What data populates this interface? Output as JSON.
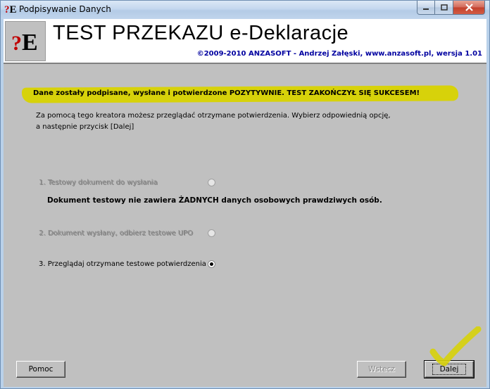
{
  "window": {
    "title": "Podpisywanie Danych",
    "icon_q": "?",
    "icon_e": "E"
  },
  "banner": {
    "logo_q": "?",
    "logo_e": "E",
    "title": "TEST PRZEKAZU e-Deklaracje",
    "subtitle": "©2009-2010 ANZASOFT - Andrzej Załęski, www.anzasoft.pl, wersja 1.01"
  },
  "status": {
    "message": "Dane zostały podpisane, wysłane i potwierdzone POZYTYWNIE. TEST ZAKOŃCZYŁ SIĘ SUKCESEM!",
    "highlight_color": "#d7d20a"
  },
  "description": {
    "line1": "Za pomocą tego kreatora możesz przeglądać otrzymane potwierdzenia. Wybierz odpowiednią opcję,",
    "line2": "a następnie przycisk [Dalej]"
  },
  "options": [
    {
      "label": "1. Testowy dokument do wysłania",
      "enabled": false,
      "selected": false
    },
    {
      "label": "2. Dokument wysłany, odbierz testowe UPO",
      "enabled": false,
      "selected": false
    },
    {
      "label": "3. Przeglądaj otrzymane testowe potwierdzenia",
      "enabled": true,
      "selected": true
    }
  ],
  "note": "Dokument testowy nie zawiera ŻADNYCH danych osobowych prawdziwych osób.",
  "buttons": {
    "help": "Pomoc",
    "back": "Wstecz",
    "next": "Dalej"
  }
}
